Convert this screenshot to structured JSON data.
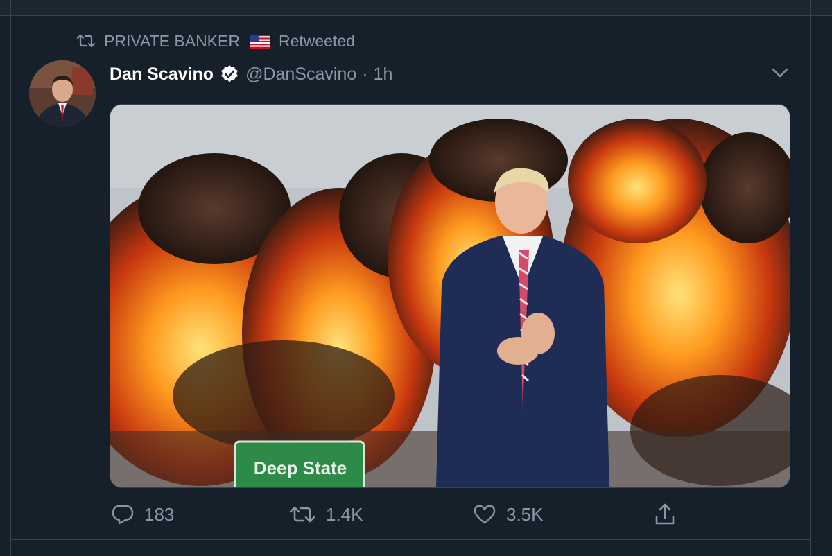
{
  "retweet": {
    "icon": "retweet-icon",
    "by": "PRIVATE BANKER",
    "flag": "us-flag-icon",
    "label": "Retweeted"
  },
  "tweet": {
    "display_name": "Dan Scavino",
    "verified": true,
    "handle": "@DanScavino",
    "separator": "·",
    "time": "1h",
    "media": {
      "sign_text": "Deep State"
    }
  },
  "actions": {
    "replies": "183",
    "retweets": "1.4K",
    "likes": "3.5K"
  },
  "colors": {
    "background": "#15202b",
    "muted": "#8899a6",
    "border": "#38444d",
    "verified_badge": "#ffffff"
  }
}
